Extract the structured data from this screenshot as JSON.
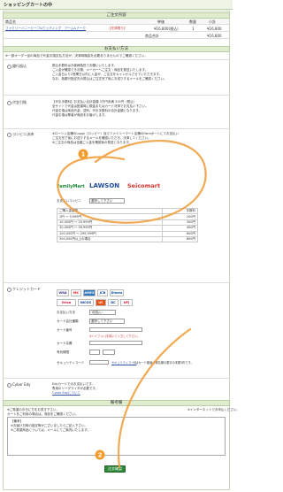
{
  "header": {
    "title": "ショッピングカートの中"
  },
  "cart": {
    "section_title": "ご注文内容",
    "columns": [
      "商品名",
      "単価",
      "数量",
      "小計"
    ],
    "item": {
      "name": "ファミリーハニービーフ&ウェディング　アーム&ナーク",
      "note": "【在庫限り】",
      "price": "¥16,800(税込)",
      "qty": "1",
      "subtotal": "¥16,800"
    },
    "total_label": "商品合計",
    "total_value": "¥16,800"
  },
  "payment": {
    "section_title": "お支払い方法",
    "note": "※一部オーダー品の商品で代金引換支払方法が、決済時機会を必要ありませんのでご確認ください。",
    "methods": [
      {
        "label": "銀行振込",
        "text": [
          "振込手数料はお客様負担でお願いいたします。",
          "ご入金が確認でき次第、メーカーへご注文・商品を発送いたします。",
          "ご入金日より2営業日以内に入金が、ご注文をキャンセルさせていただきます。",
          "なお、各銀行指定先の振込はご注文完了後にお送りするメールをご確認ください。"
        ]
      },
      {
        "label": "代金引換",
        "text": [
          "【代引手数料】お支払い合計金額 3万円未満 315円（税込）",
          "全サイトで代金は配達時に現金またはカード決済でお支払い下さい。",
          "代金引換は商品代金、送料、代引手数料の合計金額となります。",
          "代金引換は業者が商品をお届けします。"
        ]
      },
      {
        "label": "コンビニ決済",
        "text": [
          "※ローソン店舗のLoppi（ロッピー）及びファミリーマート店舗のFamiポートにてお支払い",
          "ご注文完了後にお送りするメールを確認いただき、決済してください。",
          "※ご注文の商品は全額ご入金を確認後の発送となります。"
        ],
        "stores": [
          "FamilyMart",
          "LAWSON",
          "Seicomart"
        ],
        "conv_label": "お支払いコンビニ",
        "conv_select": "選択して下さい",
        "fee_title": "ご購入金額帯",
        "fee_head": "手数料",
        "fee_rows": [
          [
            "1円 〜 9,999円",
            "200円"
          ],
          [
            "10,000円 〜 29,999円",
            "300円"
          ],
          [
            "30,000円 〜 99,999円",
            "400円"
          ],
          [
            "100,000円 〜 299,999円",
            "600円"
          ],
          [
            "300,000円以上の場合",
            "800円"
          ]
        ]
      },
      {
        "label": "クレジットカード",
        "cards": [
          "VISA",
          "MC",
          "AMEX",
          "JCB",
          "Diners",
          "Orico",
          "NICOS",
          "UC",
          "DC",
          "UFJ"
        ],
        "count_label": "お支払い方法",
        "count_value": "1回払い",
        "cardtype_label": "カード会社種類",
        "cardtype_value": "選択して下さい",
        "number_label": "カード番号",
        "number_hint": "※ハイフン(-)を除いて入力して下さい。",
        "name_label": "カード名義",
        "expiry_label": "有効期限",
        "cvv_label": "セキュリティコード",
        "cvv_link": "セキュリティコード",
        "cvv_text": "とはカード裏面の署名欄の数字の末尾3桁です。"
      },
      {
        "label": "Cyber Edy",
        "text": [
          "Edyカードでのお支払いです。",
          "専用のリーダライタが必要です。",
          "Cyber Edyについて"
        ]
      }
    ]
  },
  "memo": {
    "section_title": "備考欄",
    "notes": [
      "※ご希望のお日にちをお書き下さい。",
      "カートをご利用の場合は、商品をご確認ください。"
    ],
    "lines": [
      "【備考】",
      "※お届け日時の指定等がございましたらご記入下さい。",
      "※ご希望商品については、メールにてご案内いたします。"
    ],
    "caution": "※インターネットでお申込ください。"
  },
  "actions": {
    "confirm_label": "注文確認"
  }
}
